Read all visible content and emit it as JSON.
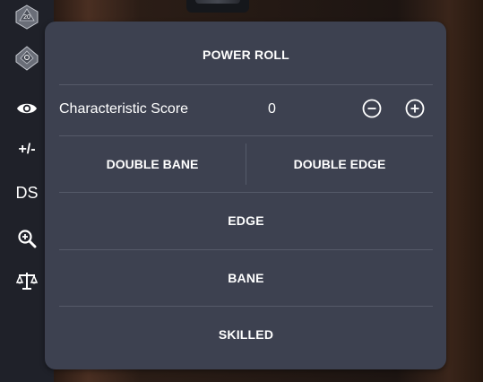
{
  "sidebar": {
    "items": [
      {
        "name": "d20-dice-icon",
        "type": "icon",
        "label": "20"
      },
      {
        "name": "d10-dice-icon",
        "type": "icon"
      },
      {
        "name": "eye-icon",
        "type": "icon"
      },
      {
        "name": "modifier-button",
        "type": "text",
        "label": "+/-"
      },
      {
        "name": "ds-button",
        "type": "text",
        "label": "DS"
      },
      {
        "name": "zoom-in-icon",
        "type": "icon"
      },
      {
        "name": "scales-icon",
        "type": "icon"
      }
    ]
  },
  "panel": {
    "title": "POWER ROLL",
    "characteristic": {
      "label": "Characteristic Score",
      "value": "0",
      "decrement_icon": "minus-circle-icon",
      "increment_icon": "plus-circle-icon"
    },
    "double_bane_label": "DOUBLE BANE",
    "double_edge_label": "DOUBLE EDGE",
    "edge_label": "EDGE",
    "bane_label": "BANE",
    "skilled_label": "SKILLED"
  },
  "colors": {
    "panel_bg": "#3d4150",
    "sidebar_bg": "#1f2129",
    "text": "#ffffff",
    "divider": "#555a69"
  }
}
